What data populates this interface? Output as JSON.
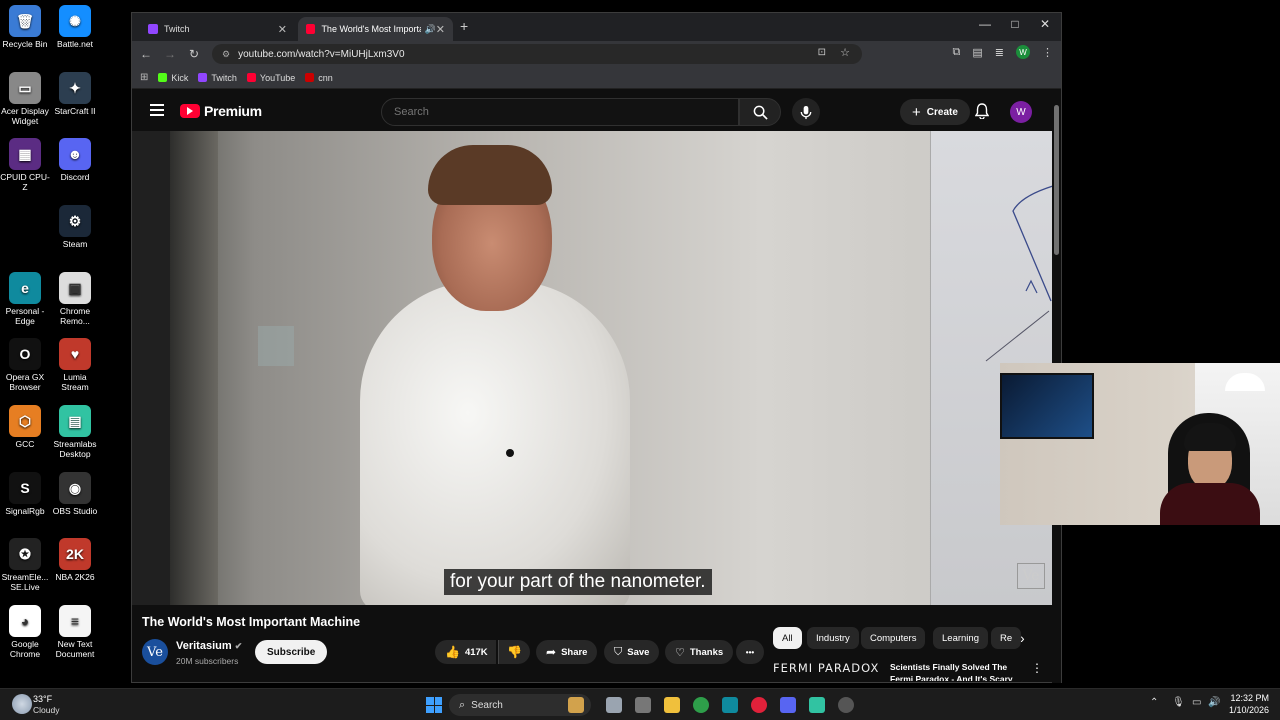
{
  "desktop": {
    "icons": [
      {
        "label": "Recycle Bin",
        "color": "#3a7bd5",
        "glyph": "🗑"
      },
      {
        "label": "Battle.net",
        "color": "#148eff",
        "glyph": "✺"
      },
      {
        "label": "Acer Display Widget",
        "color": "#888888",
        "glyph": "▭"
      },
      {
        "label": "StarCraft II",
        "color": "#2c3e50",
        "glyph": "✦"
      },
      {
        "label": "CPUID CPU-Z",
        "color": "#5b2c83",
        "glyph": "▦"
      },
      {
        "label": "Discord",
        "color": "#5865f2",
        "glyph": "☻"
      },
      {
        "label": "Steam",
        "color": "#1b2838",
        "glyph": "⚙"
      },
      {
        "label": "Personal - Edge",
        "color": "#0f8a9e",
        "glyph": "e"
      },
      {
        "label": "Chrome Remo...",
        "color": "#dddddd",
        "glyph": "▣"
      },
      {
        "label": "Opera GX Browser",
        "color": "#111111",
        "glyph": "O"
      },
      {
        "label": "Lumia Stream",
        "color": "#c0392b",
        "glyph": "♥"
      },
      {
        "label": "GCC",
        "color": "#e67e22",
        "glyph": "⬡"
      },
      {
        "label": "Streamlabs Desktop",
        "color": "#31c3a2",
        "glyph": "▤"
      },
      {
        "label": "SignalRgb",
        "color": "#111111",
        "glyph": "S"
      },
      {
        "label": "OBS Studio",
        "color": "#333333",
        "glyph": "◉"
      },
      {
        "label": "StreamEle... SE.Live",
        "color": "#222222",
        "glyph": "✪"
      },
      {
        "label": "NBA 2K26",
        "color": "#c0392b",
        "glyph": "2K"
      },
      {
        "label": "Google Chrome",
        "color": "#ffffff",
        "glyph": "◕"
      },
      {
        "label": "New Text Document",
        "color": "#f5f5f5",
        "glyph": "≡"
      }
    ]
  },
  "browser": {
    "tabs": [
      {
        "title": "Twitch",
        "color": "#9146ff"
      },
      {
        "title": "The World's Most Importan",
        "color": "#ff0033"
      }
    ],
    "new_tab": "+",
    "window_controls": {
      "minimize": "—",
      "maximize": "□",
      "close": "✕"
    },
    "url": "youtube.com/watch?v=MiUHjLxm3V0",
    "bookmarks": [
      {
        "label": "Kick",
        "color": "#53fc18"
      },
      {
        "label": "Twitch",
        "color": "#9146ff"
      },
      {
        "label": "YouTube",
        "color": "#ff0033"
      },
      {
        "label": "cnn",
        "color": "#cc0000"
      }
    ],
    "profile_initial": "W"
  },
  "youtube": {
    "logo_text": "Premium",
    "search_placeholder": "Search",
    "create_label": "Create",
    "avatar_initial": "W",
    "caption": "for your part of the nanometer.",
    "watermark": "Ve",
    "video_title": "The World's Most Important Machine",
    "channel": {
      "name": "Veritasium",
      "subscribers": "20M subscribers",
      "avatar_text": "Ve"
    },
    "subscribe_label": "Subscribe",
    "likes": "417K",
    "share_label": "Share",
    "save_label": "Save",
    "thanks_label": "Thanks",
    "more_label": "•••",
    "chips": [
      "All",
      "Industry",
      "Computers",
      "Learning",
      "Re"
    ],
    "recommendation": {
      "thumb_text": "FERMI PARADOX",
      "title": "Scientists Finally Solved The Fermi Paradox - And It's Scary"
    }
  },
  "taskbar": {
    "weather_temp": "33°F",
    "weather_desc": "Cloudy",
    "search_label": "Search",
    "time": "12:32 PM",
    "date": "1/10/2026"
  }
}
